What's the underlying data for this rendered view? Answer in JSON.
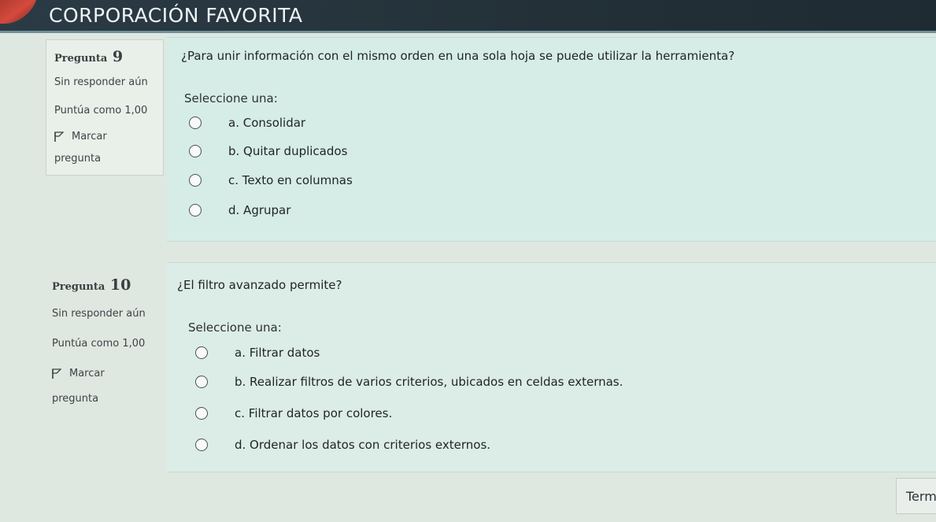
{
  "header": {
    "title": "CORPORACIÓN FAVORITA"
  },
  "questions": [
    {
      "label": "Pregunta",
      "number": "9",
      "state": "Sin responder aún",
      "grade": "Puntúa como 1,00",
      "flag_label_1": "Marcar",
      "flag_label_2": "pregunta",
      "text": "¿Para unir información con el mismo orden en una sola hoja se puede utilizar la herramienta?",
      "prompt": "Seleccione una:",
      "options": [
        "a. Consolidar",
        "b. Quitar duplicados",
        "c. Texto en columnas",
        "d. Agrupar"
      ]
    },
    {
      "label": "Pregunta",
      "number": "10",
      "state": "Sin responder aún",
      "grade": "Puntúa como 1,00",
      "flag_label_1": "Marcar",
      "flag_label_2": "pregunta",
      "text": "¿El filtro avanzado permite?",
      "prompt": "Seleccione una:",
      "options": [
        "a. Filtrar datos",
        "b. Realizar filtros de varios criterios, ubicados en celdas externas.",
        "c. Filtrar datos por colores.",
        "d. Ordenar los datos con criterios externos."
      ]
    }
  ],
  "footer": {
    "finish_label": "Termi"
  },
  "icons": {
    "flag": "flag-icon",
    "logo": "logo-mark"
  },
  "colors": {
    "header_bg": "#233038",
    "content_bg": "#d6ece6",
    "info_bg": "#e9efe9"
  }
}
